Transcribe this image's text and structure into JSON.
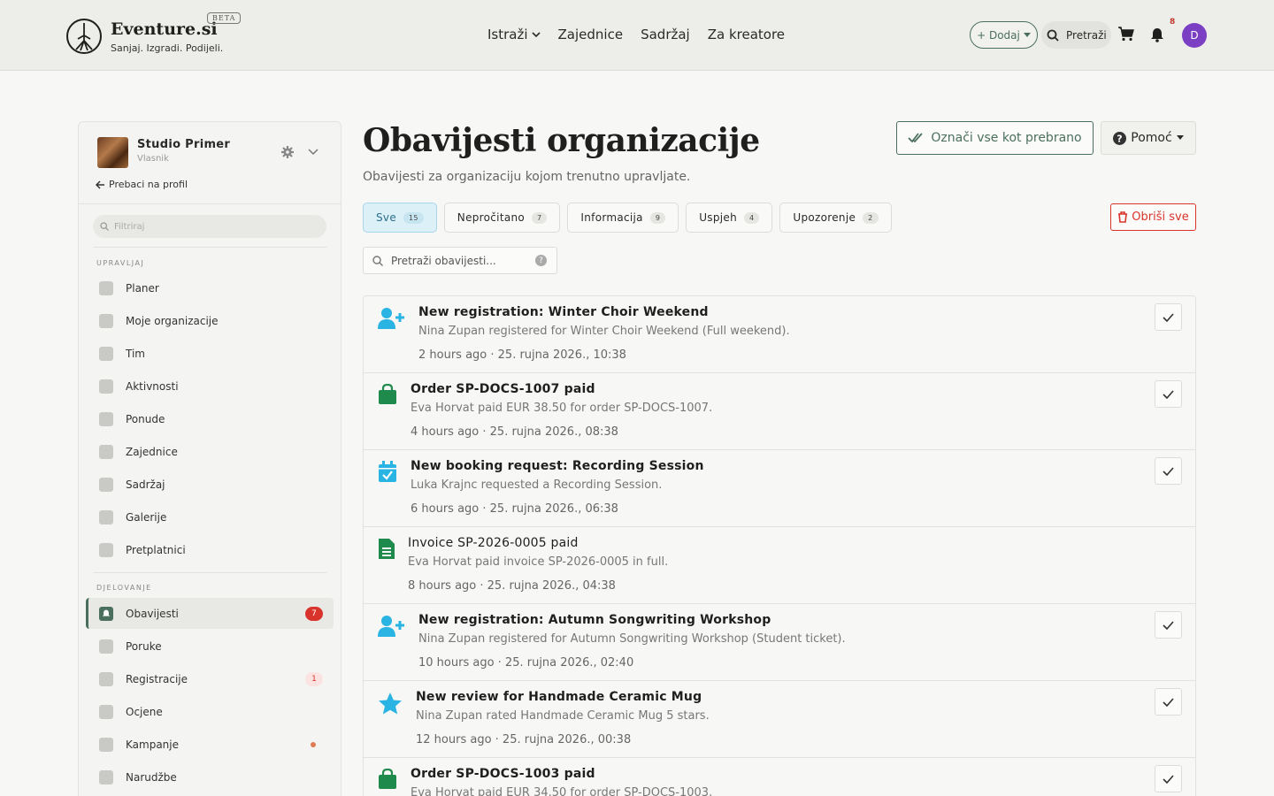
{
  "header": {
    "brand": "Eventure.si",
    "beta": "BETA",
    "tagline": "Sanjaj. Izgradi. Podijeli.",
    "nav": [
      "Istraži",
      "Zajednice",
      "Sadržaj",
      "Za kreatore"
    ],
    "add_label": "+ Dodaj",
    "search_label": "Pretraži",
    "notif_count": "8",
    "avatar_letter": "D"
  },
  "sidebar": {
    "org_name": "Studio Primer",
    "org_role": "Vlasnik",
    "switch_label": "Prebaci na profil",
    "filter_placeholder": "Filtriraj",
    "section_manage": "UPRAVLJAJ",
    "manage_items": [
      "Planer",
      "Moje organizacije",
      "Tim",
      "Aktivnosti",
      "Ponude",
      "Zajednice",
      "Sadržaj",
      "Galerije",
      "Pretplatnici"
    ],
    "section_act": "DJELOVANJE",
    "act_items": [
      "Obavijesti",
      "Poruke",
      "Registracije",
      "Ocjene",
      "Kampanje",
      "Narudžbe"
    ],
    "obavijesti_badge": "7",
    "registracije_badge": "1"
  },
  "main": {
    "title": "Obavijesti organizacije",
    "subtitle": "Obavijesti za organizaciju kojom trenutno upravljate.",
    "mark_all": "Označi vse kot prebrano",
    "help": "Pomoć",
    "delete_all": "Obriši sve",
    "search_placeholder": "Pretraži obavijesti...",
    "tabs": [
      {
        "label": "Sve",
        "count": "15"
      },
      {
        "label": "Nepročitano",
        "count": "7"
      },
      {
        "label": "Informacija",
        "count": "9"
      },
      {
        "label": "Uspjeh",
        "count": "4"
      },
      {
        "label": "Upozorenje",
        "count": "2"
      }
    ]
  },
  "notifications": [
    {
      "title": "New registration: Winter Choir Weekend",
      "desc": "Nina Zupan registered for Winter Choir Weekend (Full weekend).",
      "time": "2 hours ago · 25. rujna 2026., 10:38",
      "icon": "user-plus-icon",
      "unread": true
    },
    {
      "title": "Order SP-DOCS-1007 paid",
      "desc": "Eva Horvat paid EUR 38.50 for order SP-DOCS-1007.",
      "time": "4 hours ago · 25. rujna 2026., 08:38",
      "icon": "shopping-bag-icon",
      "unread": true
    },
    {
      "title": "New booking request: Recording Session",
      "desc": "Luka Krajnc requested a Recording Session.",
      "time": "6 hours ago · 25. rujna 2026., 06:38",
      "icon": "calendar-check-icon",
      "unread": true
    },
    {
      "title": "Invoice SP-2026-0005 paid",
      "desc": "Eva Horvat paid invoice SP-2026-0005 in full.",
      "time": "8 hours ago · 25. rujna 2026., 04:38",
      "icon": "invoice-icon",
      "unread": false
    },
    {
      "title": "New registration: Autumn Songwriting Workshop",
      "desc": "Nina Zupan registered for Autumn Songwriting Workshop (Student ticket).",
      "time": "10 hours ago · 25. rujna 2026., 02:40",
      "icon": "user-plus-icon",
      "unread": true
    },
    {
      "title": "New review for Handmade Ceramic Mug",
      "desc": "Nina Zupan rated Handmade Ceramic Mug 5 stars.",
      "time": "12 hours ago · 25. rujna 2026., 00:38",
      "icon": "star-icon",
      "unread": true
    },
    {
      "title": "Order SP-DOCS-1003 paid",
      "desc": "Eva Horvat paid EUR 34.50 for order SP-DOCS-1003.",
      "time": "",
      "icon": "shopping-bag-icon",
      "unread": true
    }
  ],
  "colors": {
    "accent": "#4b6f5e",
    "danger": "#d9342b",
    "info": "#2ab4e3",
    "success": "#1e8a4c"
  }
}
